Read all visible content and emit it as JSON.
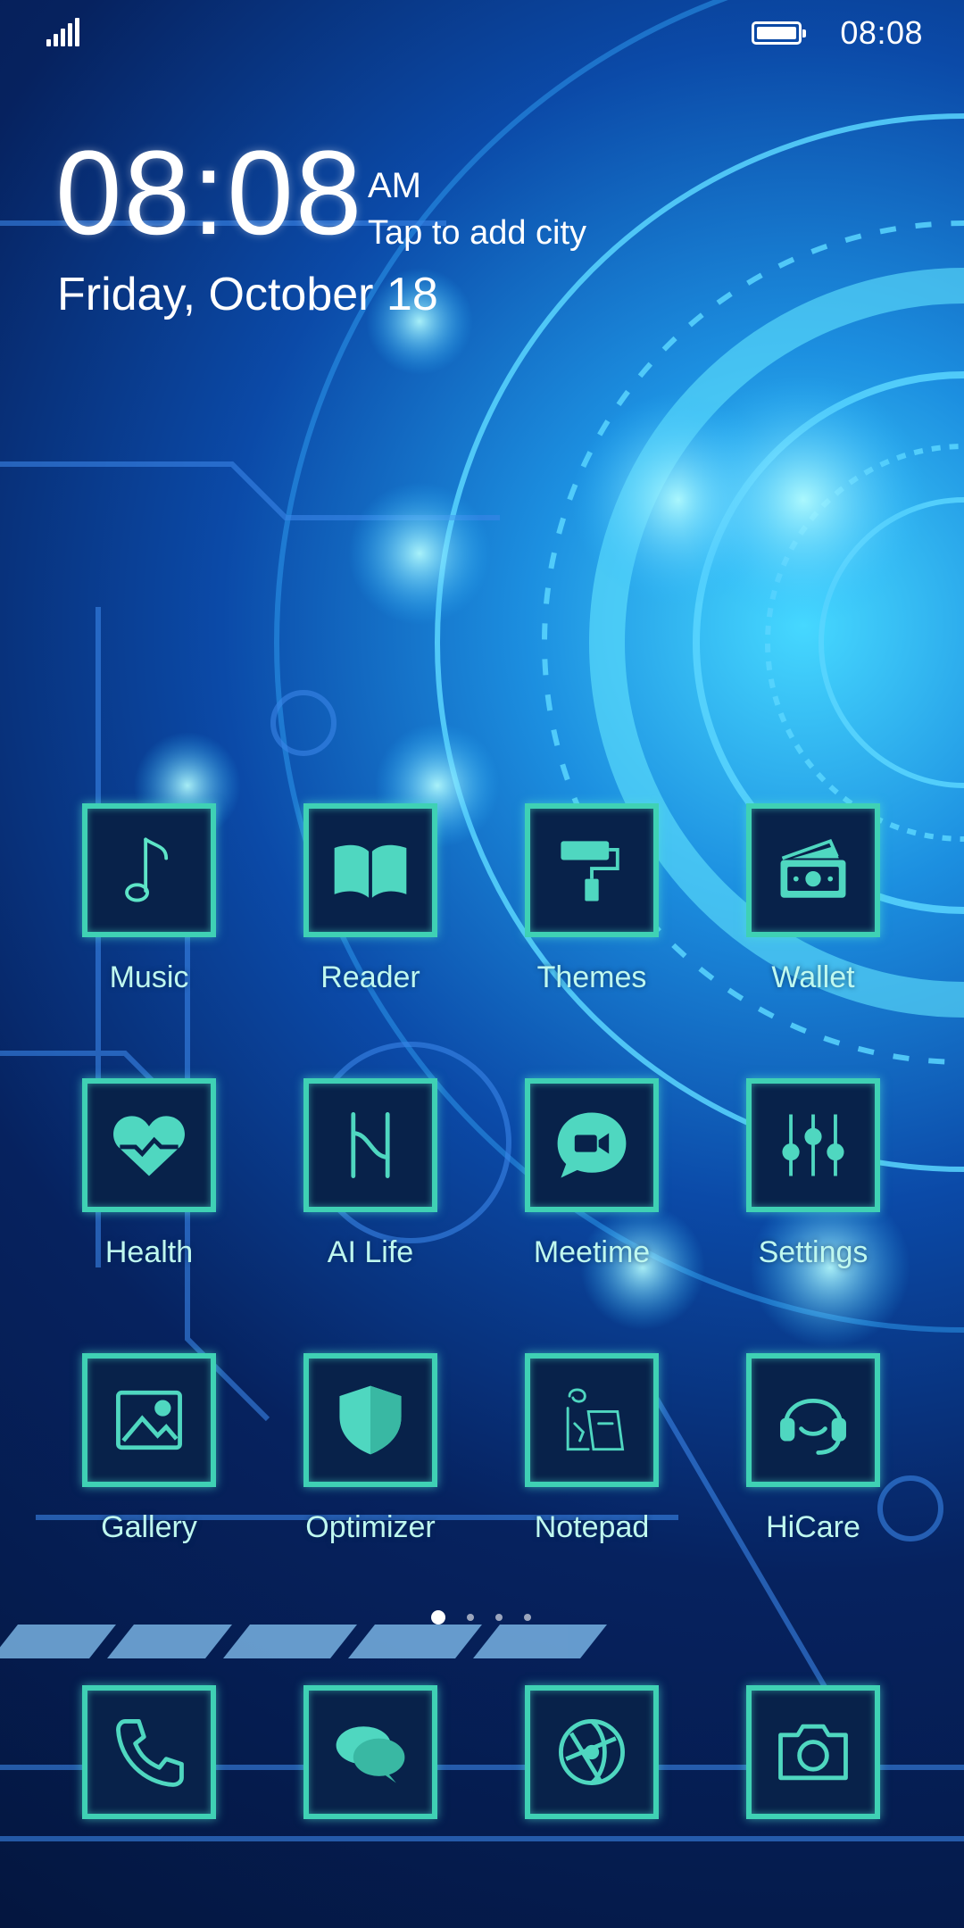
{
  "status_bar": {
    "time": "08:08",
    "signal_icon": "signal-bars-icon",
    "battery_icon": "battery-full-icon"
  },
  "clock_widget": {
    "time": "08:08",
    "ampm": "AM",
    "city_hint": "Tap to add city",
    "date": "Friday, October 18"
  },
  "apps": [
    {
      "label": "Music",
      "icon": "music-note-icon"
    },
    {
      "label": "Reader",
      "icon": "open-book-icon"
    },
    {
      "label": "Themes",
      "icon": "paint-roller-icon"
    },
    {
      "label": "Wallet",
      "icon": "wallet-cash-icon"
    },
    {
      "label": "Health",
      "icon": "heart-icon"
    },
    {
      "label": "AI Life",
      "icon": "ai-life-icon"
    },
    {
      "label": "Meetime",
      "icon": "video-chat-icon"
    },
    {
      "label": "Settings",
      "icon": "sliders-icon"
    },
    {
      "label": "Gallery",
      "icon": "picture-icon"
    },
    {
      "label": "Optimizer",
      "icon": "shield-icon"
    },
    {
      "label": "Notepad",
      "icon": "notepad-icon"
    },
    {
      "label": "HiCare",
      "icon": "headset-icon"
    }
  ],
  "page_indicator": {
    "pages": 4,
    "current": 1
  },
  "dock": [
    {
      "icon": "phone-icon"
    },
    {
      "icon": "messages-icon"
    },
    {
      "icon": "browser-globe-icon"
    },
    {
      "icon": "camera-icon"
    }
  ],
  "colors": {
    "icon_border": "#3fd1b4",
    "icon_fill": "#08224a",
    "label_color": "#bff8ef",
    "glow": "#46d8ff"
  }
}
